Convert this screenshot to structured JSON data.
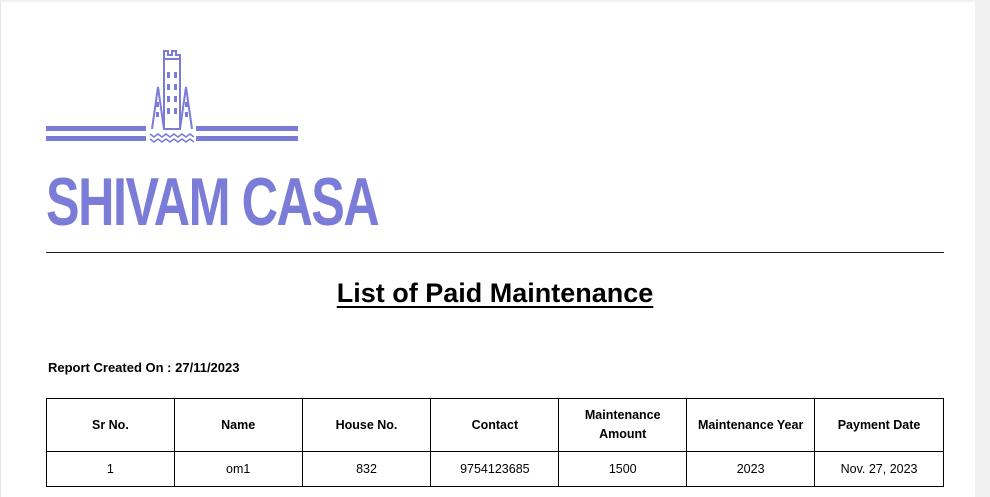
{
  "logo": {
    "text": "SHIVAM CASA",
    "color": "#7b7bd8",
    "icon": "tower-building-icon"
  },
  "title": "List of Paid Maintenance",
  "report_created": "Report Created On : 27/11/2023",
  "table": {
    "headers": [
      "Sr No.",
      "Name",
      "House No.",
      "Contact",
      "Maintenance Amount",
      "Maintenance Year",
      "Payment Date"
    ],
    "rows": [
      [
        "1",
        "om1",
        "832",
        "9754123685",
        "1500",
        "2023",
        "Nov. 27, 2023"
      ]
    ]
  }
}
